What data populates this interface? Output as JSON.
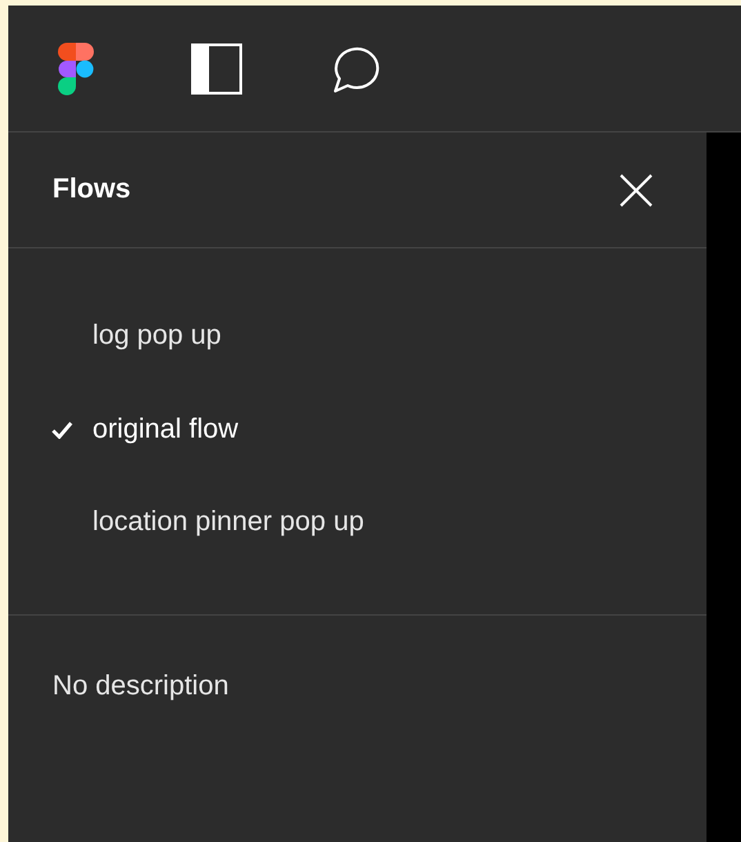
{
  "flows_panel": {
    "title": "Flows",
    "items": [
      {
        "label": "log pop up",
        "selected": false
      },
      {
        "label": "original flow",
        "selected": true
      },
      {
        "label": "location pinner pop up",
        "selected": false
      }
    ],
    "description": "No description"
  }
}
